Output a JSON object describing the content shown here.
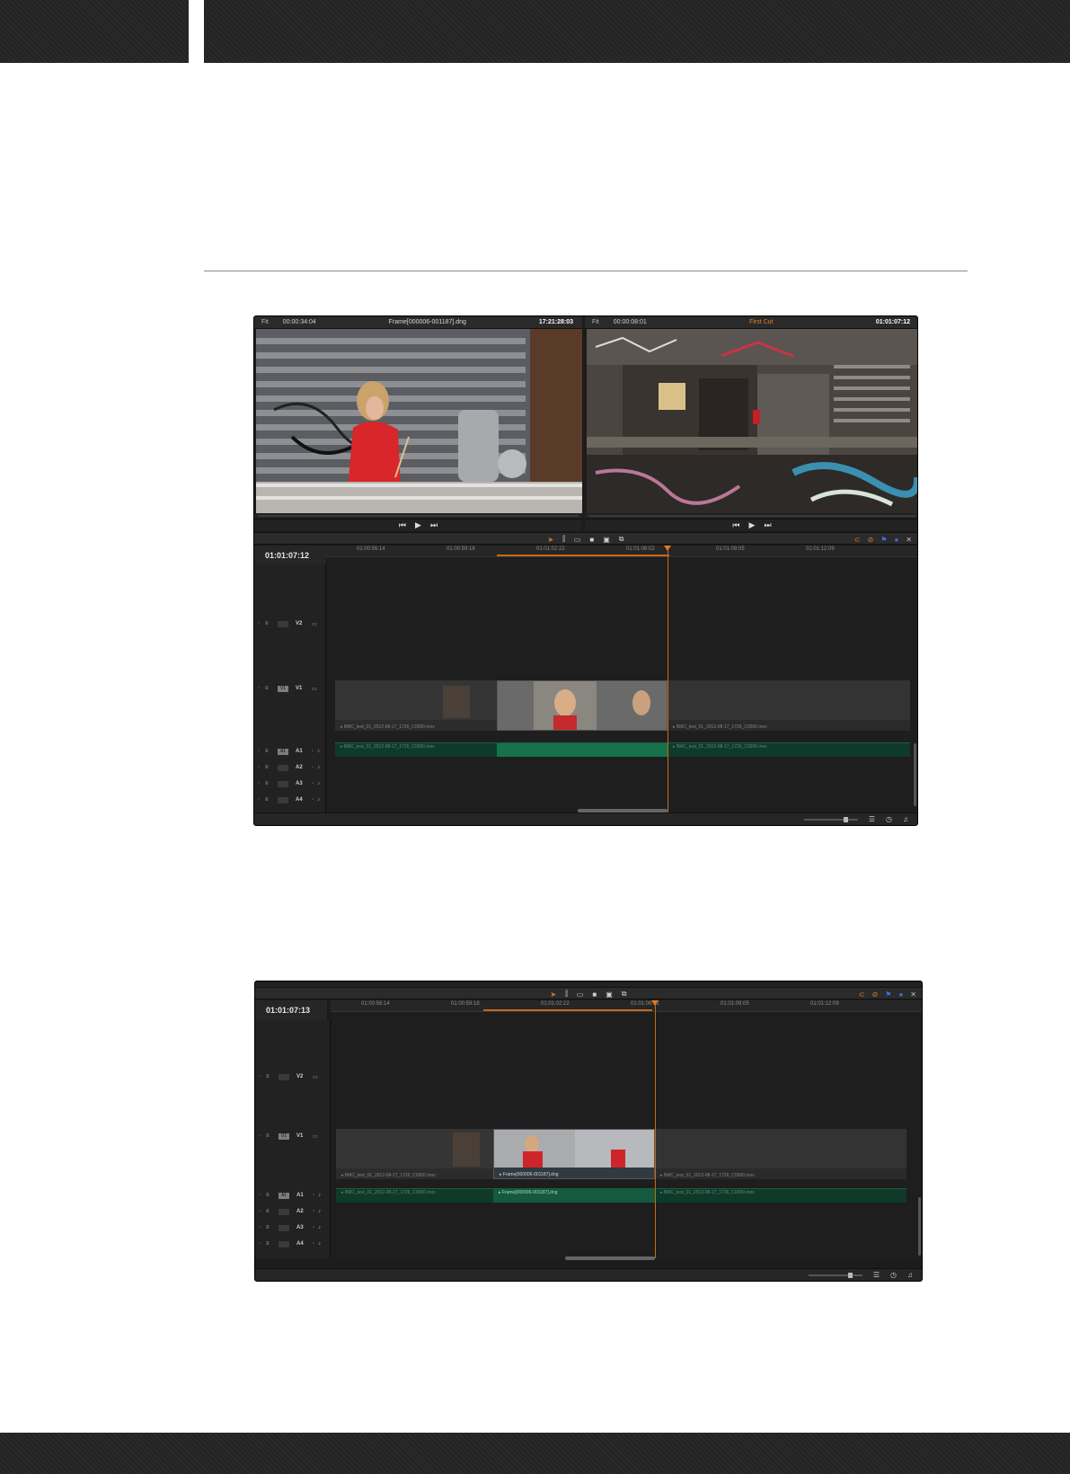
{
  "shot1": {
    "source": {
      "fit": "Fit",
      "timecode": "00:00:34:04",
      "clip_name": "Frame[000006-001187].dng",
      "right_timecode": "17:21:28:03"
    },
    "record": {
      "fit": "Fit",
      "timecode": "00:00:08:01",
      "timeline_name": "First Cut",
      "right_timecode": "01:01:07:12"
    },
    "timeline_timecode": "01:01:07:12",
    "ruler": [
      "01:00:56:14",
      "01:00:59:18",
      "01:01:02:22",
      "01:01:06:02",
      "01:01:09:05",
      "01:01:12:09"
    ],
    "tracks": {
      "v2": "V2",
      "v1": "V1",
      "v1_patch": "V1",
      "a1": "A1",
      "a1_patch": "A1",
      "a2": "A2",
      "a3": "A3",
      "a4": "A4"
    },
    "clip_labels": {
      "v1_left": "▸ BMC_test_01_2012-08-17_1726_C0000.mov",
      "v1_right": "▸ BMC_test_01_2012-08-17_1726_C0000.mov",
      "a1_left": "▸ BMC_test_01_2012-08-17_1726_C0000.mov",
      "a1_right": "▸ BMC_test_01_2012-08-17_1726_C0000.mov"
    }
  },
  "shot2": {
    "timeline_timecode": "01:01:07:13",
    "ruler": [
      "01:00:56:14",
      "01:00:59:18",
      "01:01:02:22",
      "01:01:06:02",
      "01:01:09:05",
      "01:01:12:09"
    ],
    "tracks": {
      "v2": "V2",
      "v1": "V1",
      "v1_patch": "V1",
      "a1": "A1",
      "a1_patch": "A1",
      "a2": "A2",
      "a3": "A3",
      "a4": "A4"
    },
    "clip_labels": {
      "v1_left": "▸ BMC_test_01_2012-08-17_1726_C0000.mov",
      "v1_mid": "▸ Frame[000006-001187].dng",
      "v1_right": "▸ BMC_test_01_2012-08-17_1726_C0000.mov",
      "a1_left": "▸ BMC_test_01_2012-08-17_1726_C0000.mov",
      "a1_mid": "▸ Frame[000006-001187].dng",
      "a1_right": "▸ BMC_test_01_2012-08-17_1726_C0000.mov"
    }
  },
  "icons": {
    "transport": [
      "skip-back-icon",
      "play-icon",
      "skip-forward-icon"
    ],
    "tools": [
      "selection-arrow-icon",
      "trim-icon",
      "blade-icon",
      "insert-icon",
      "overwrite-icon",
      "replace-icon"
    ],
    "right_tools": [
      "snapping-icon",
      "linked-selection-icon",
      "flag-icon",
      "marker-icon"
    ],
    "status": [
      "zoom-slider",
      "timeline-options-icon",
      "clock-icon",
      "audio-icon"
    ]
  },
  "colors": {
    "accent": "#e07a22",
    "audio_clip": "#0f3a2a",
    "audio_selected": "#17714d",
    "playhead": "#c36a1a"
  }
}
